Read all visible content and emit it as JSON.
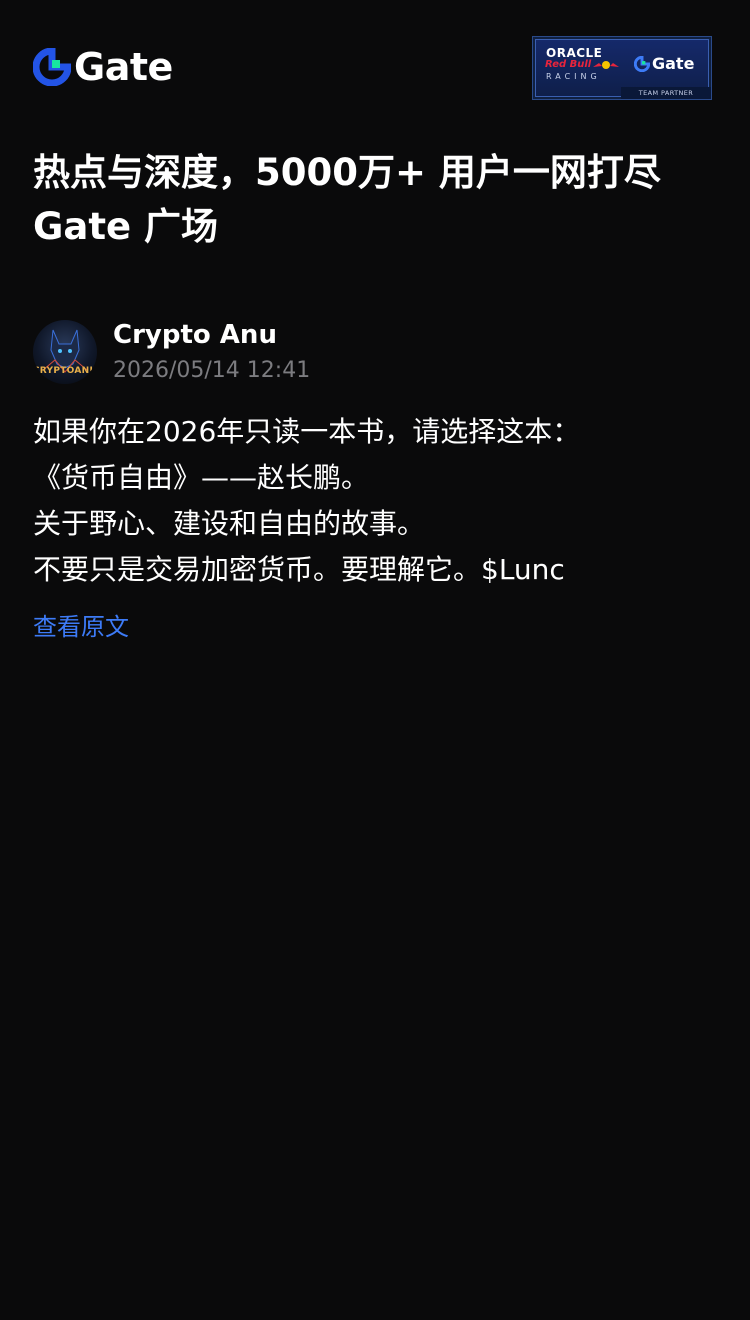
{
  "header": {
    "logo_text": "Gate",
    "partner": {
      "oracle": "ORACLE",
      "redbull": "Red Bull",
      "racing": "RACING",
      "gate": "Gate",
      "team_partner": "TEAM PARTNER"
    }
  },
  "headline": {
    "line1": "热点与深度，5000万+ 用户一网打尽",
    "line2": "Gate 广场"
  },
  "post": {
    "author_name": "Crypto Anu",
    "avatar_text": "CRYPTOANU",
    "timestamp": "2026/05/14 12:41",
    "lines": [
      "如果你在2026年只读一本书，请选择这本：",
      "《货币自由》——赵长鹏。",
      "关于野心、建设和自由的故事。",
      "不要只是交易加密货币。要理解它。$Lunc"
    ],
    "view_original_label": "查看原文"
  },
  "colors": {
    "background": "#0a0a0b",
    "text": "#ffffff",
    "muted": "#7c7c80",
    "link": "#3d7bf7",
    "gate_blue": "#2354e6",
    "gate_green": "#17e5a0"
  }
}
